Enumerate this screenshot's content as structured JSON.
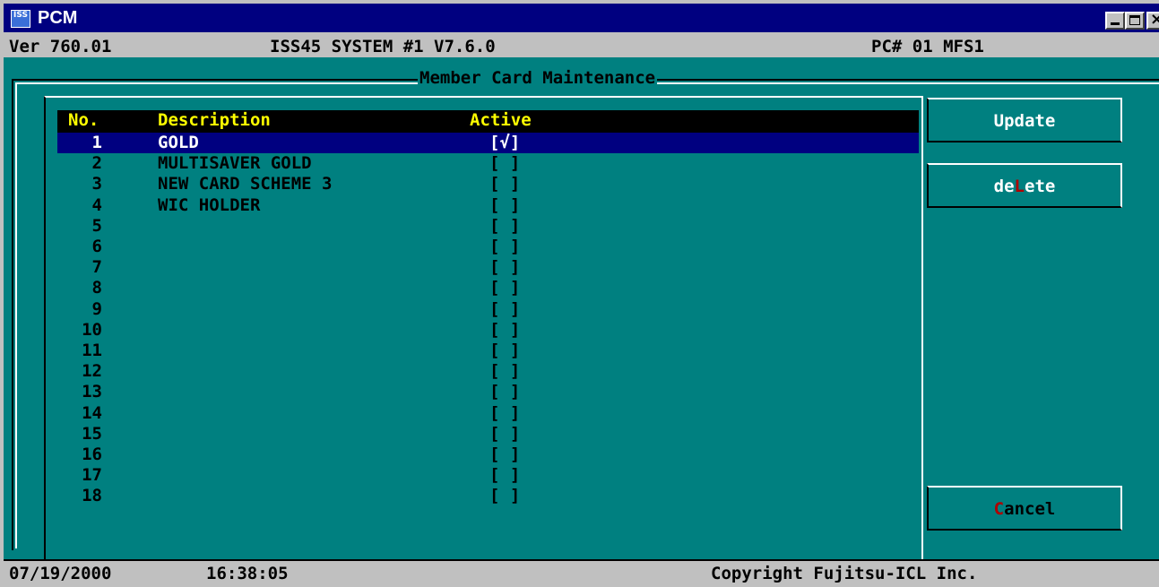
{
  "window": {
    "title": "PCM",
    "icon": "app-icon",
    "icon_text": "ISS"
  },
  "header": {
    "version": "Ver 760.01",
    "system": "ISS45 SYSTEM #1 V7.6.0",
    "pc": "PC# 01 MFS1"
  },
  "frame_title": "Member Card Maintenance",
  "list": {
    "columns": {
      "no": "No.",
      "description": "Description",
      "active": "Active"
    },
    "rows": [
      {
        "no": "1",
        "description": "GOLD",
        "active": "[√]"
      },
      {
        "no": "2",
        "description": "MULTISAVER GOLD",
        "active": "[ ]"
      },
      {
        "no": "3",
        "description": "NEW CARD SCHEME 3",
        "active": "[ ]"
      },
      {
        "no": "4",
        "description": "WIC HOLDER",
        "active": "[ ]"
      },
      {
        "no": "5",
        "description": "",
        "active": "[ ]"
      },
      {
        "no": "6",
        "description": "",
        "active": "[ ]"
      },
      {
        "no": "7",
        "description": "",
        "active": "[ ]"
      },
      {
        "no": "8",
        "description": "",
        "active": "[ ]"
      },
      {
        "no": "9",
        "description": "",
        "active": "[ ]"
      },
      {
        "no": "10",
        "description": "",
        "active": "[ ]"
      },
      {
        "no": "11",
        "description": "",
        "active": "[ ]"
      },
      {
        "no": "12",
        "description": "",
        "active": "[ ]"
      },
      {
        "no": "13",
        "description": "",
        "active": "[ ]"
      },
      {
        "no": "14",
        "description": "",
        "active": "[ ]"
      },
      {
        "no": "15",
        "description": "",
        "active": "[ ]"
      },
      {
        "no": "16",
        "description": "",
        "active": "[ ]"
      },
      {
        "no": "17",
        "description": "",
        "active": "[ ]"
      },
      {
        "no": "18",
        "description": "",
        "active": "[ ]"
      }
    ]
  },
  "buttons": {
    "update": {
      "pre": "Update",
      "hot": "",
      "post": ""
    },
    "delete": {
      "pre": "de",
      "hot": "L",
      "post": "ete"
    },
    "cancel": {
      "pre": "",
      "hot": "C",
      "post": "ancel"
    }
  },
  "footer": {
    "date": "07/19/2000",
    "time": "16:38:05",
    "copyright": "Copyright Fujitsu-ICL Inc."
  },
  "colors": {
    "background": "#008080",
    "titlebar": "#000080",
    "header_text": "#ffff00",
    "selection": "#000080",
    "hotkey": "#b00000"
  }
}
